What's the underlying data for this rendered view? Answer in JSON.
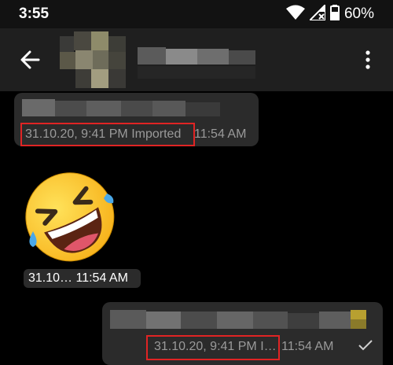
{
  "status_bar": {
    "time": "3:55",
    "battery": "60%",
    "icons": [
      "wifi-icon",
      "cellular-no-signal-icon",
      "battery-icon"
    ]
  },
  "app_bar": {
    "back_icon": "arrow-left-icon",
    "menu_icon": "more-vertical-icon"
  },
  "messages": [
    {
      "direction": "incoming",
      "type": "text",
      "original_timestamp": "31.10.20, 9:41 PM Imported",
      "time": "11:54 AM"
    },
    {
      "direction": "incoming",
      "type": "sticker",
      "sticker": "rolling-on-the-floor-laughing-emoji",
      "stamp": "31.10… 11:54 AM"
    },
    {
      "direction": "outgoing",
      "type": "text",
      "original_timestamp": "31.10.20, 9:41 PM I…",
      "time": "11:54 AM",
      "status_icon": "check-icon"
    }
  ],
  "colors": {
    "background": "#000000",
    "app_bar": "#1f1f1f",
    "bubble": "#2b2b2b",
    "meta_text": "#9a9a9a",
    "highlight": "#e02424"
  }
}
